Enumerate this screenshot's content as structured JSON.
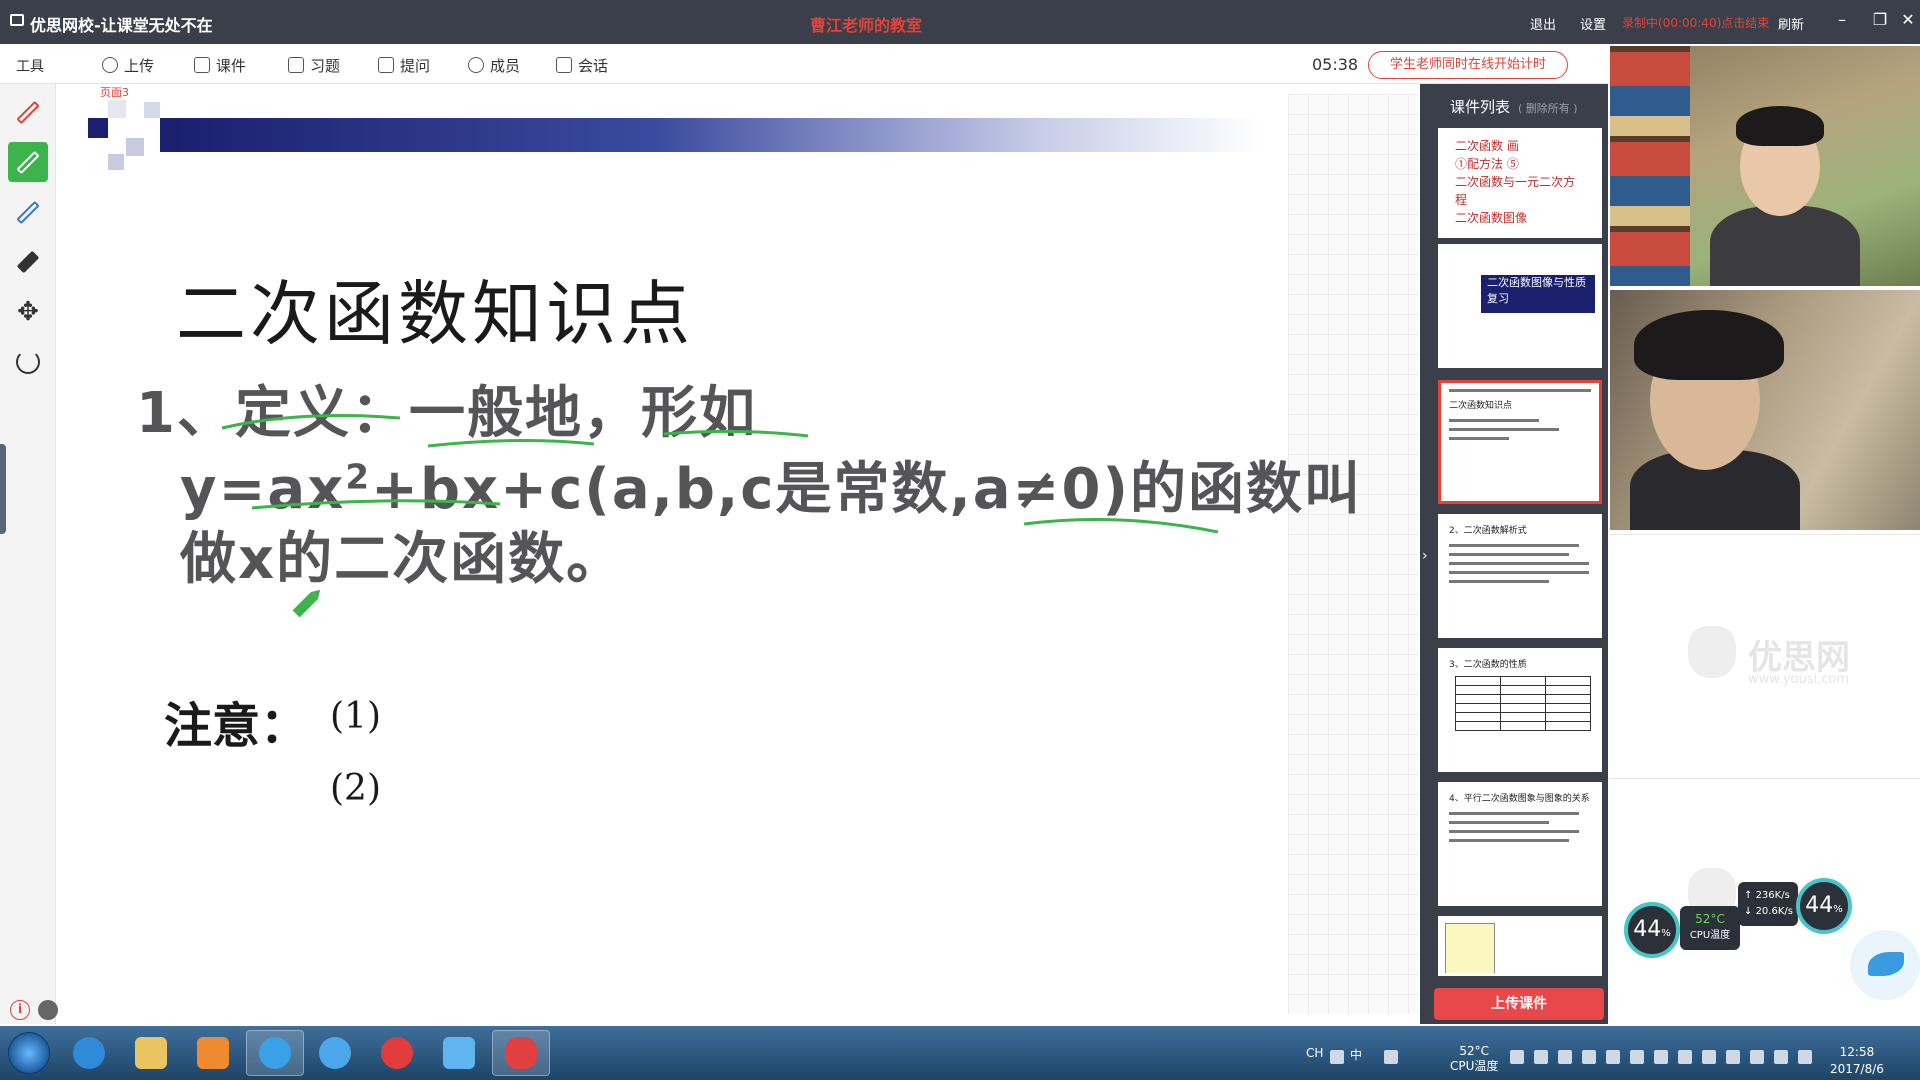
{
  "titlebar": {
    "app_title": "优思网校-让课堂无处不在",
    "room_title": "曹江老师的教室",
    "logout": "退出",
    "settings": "设置",
    "recording": "录制中(00:00:40)点击结束",
    "refresh": "刷新"
  },
  "toolbar": {
    "tools_label": "工具",
    "upload": "上传",
    "courseware": "课件",
    "exercises": "习题",
    "question": "提问",
    "members": "成员",
    "chat": "会话",
    "timer": "05:38",
    "timer_button": "学生老师同时在线开始计时"
  },
  "canvas": {
    "page_label": "页面3",
    "slide": {
      "title": "二次函数知识点",
      "def_line1": "1、定义：一般地，形如",
      "def_line2_a": "y=ax",
      "def_line2_sup": "2",
      "def_line2_b": "+bx+c(a,b,c是常数,a≠0)的函数叫",
      "def_line3": "做x的二次函数。",
      "note_label": "注意：",
      "note_1": "(1)",
      "note_2": "(2)"
    }
  },
  "courseware_panel": {
    "header": "课件列表",
    "header_sub": "( 删除所有 )",
    "thumb1_lines": [
      "二次函数  画",
      "①配方法 ⑤",
      "二次函数与一元二次方程",
      "二次函数图像"
    ],
    "thumb2_title": "二次函数图像与性质复习",
    "thumb3_title": "二次函数知识点",
    "thumb4_title": "2、二次函数解析式",
    "thumb5_title": "3、二次函数的性质",
    "thumb6_title": "4、平行二次函数图象与图象的关系",
    "upload_button": "上传课件"
  },
  "video": {
    "watermark": "优思网",
    "watermark_url": "www.yousi.com"
  },
  "widget": {
    "gauge_left": "44",
    "gauge_right": "44",
    "percent": "%",
    "cpu_temp": "52°C",
    "cpu_label": "CPU温度",
    "upload_speed": "236K/s",
    "download_speed": "20.6K/s"
  },
  "taskbar": {
    "ime": "CH",
    "ime2": "中",
    "tray_temp": "52°C",
    "tray_temp_label": "CPU温度",
    "time": "12:58",
    "date": "2017/8/6"
  },
  "colors": {
    "accent_red": "#e0443a",
    "active_green": "#3cb44b",
    "panel_dark": "#3a3f4a",
    "banner_blue": "#1a1f6e"
  }
}
